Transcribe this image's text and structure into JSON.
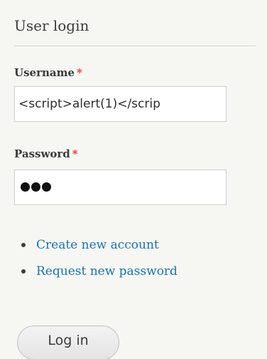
{
  "block": {
    "title": "User login"
  },
  "username": {
    "label": "Username",
    "required_mark": "*",
    "value": "<script>alert(1)</scrip"
  },
  "password": {
    "label": "Password",
    "required_mark": "*",
    "masked_char_count": 3
  },
  "links": [
    {
      "label": "Create new account"
    },
    {
      "label": "Request new password"
    }
  ],
  "actions": {
    "submit_label": "Log in"
  },
  "colors": {
    "background": "#f6f6f2",
    "link": "#1a73b6",
    "required": "#e0322c"
  }
}
